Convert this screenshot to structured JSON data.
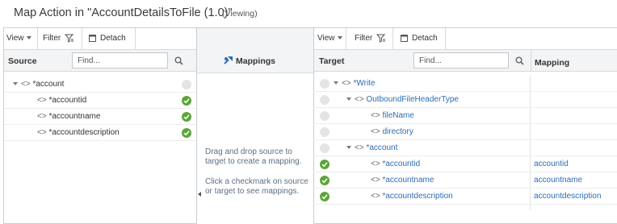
{
  "header": {
    "title": "Map Action in \"AccountDetailsToFile (1.0)\"",
    "status": "(Viewing)"
  },
  "toolbar": {
    "view_label": "View",
    "filter_label": "Filter",
    "detach_label": "Detach"
  },
  "source": {
    "heading": "Source",
    "find_placeholder": "Find...",
    "rows": [
      {
        "label": "*account",
        "mapped": false
      },
      {
        "label": "*accountid",
        "mapped": true
      },
      {
        "label": "*accountname",
        "mapped": true
      },
      {
        "label": "*accountdescription",
        "mapped": true
      }
    ]
  },
  "mappings": {
    "heading": "Mappings",
    "hint1": "Drag and drop source to target to create a mapping.",
    "hint2": "Click a checkmark on source or target to see mappings."
  },
  "target": {
    "heading": "Target",
    "mapping_heading": "Mapping",
    "find_placeholder": "Find...",
    "rows": [
      {
        "label": "*Write",
        "mapped": false,
        "mapping": ""
      },
      {
        "label": "OutboundFileHeaderType",
        "mapped": false,
        "mapping": ""
      },
      {
        "label": "fileName",
        "mapped": false,
        "mapping": ""
      },
      {
        "label": "directory",
        "mapped": false,
        "mapping": ""
      },
      {
        "label": "*account",
        "mapped": false,
        "mapping": ""
      },
      {
        "label": "*accountid",
        "mapped": true,
        "mapping": "accountid"
      },
      {
        "label": "*accountname",
        "mapped": true,
        "mapping": "accountname"
      },
      {
        "label": "*accountdescription",
        "mapped": true,
        "mapping": "accountdescription"
      }
    ]
  },
  "colors": {
    "mapped_check": "#59a63a",
    "unmapped_dot": "#e3e4e6",
    "link_text": "#2d6db5"
  }
}
